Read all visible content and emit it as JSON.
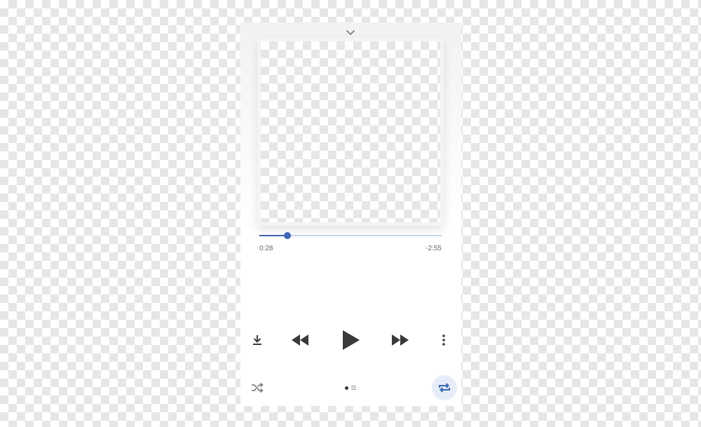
{
  "player": {
    "progress": {
      "elapsed": "0:28",
      "remaining": "-2:55",
      "fraction": 0.155
    },
    "controls": [
      {
        "name": "download",
        "icon": "download-icon"
      },
      {
        "name": "rewind",
        "icon": "rewind-icon"
      },
      {
        "name": "play",
        "icon": "play-icon"
      },
      {
        "name": "fast-forward",
        "icon": "fast-forward-icon"
      },
      {
        "name": "more",
        "icon": "more-vertical-icon"
      }
    ],
    "bottom": {
      "shuffle_icon": "shuffle-icon",
      "repeat_icon": "repeat-icon",
      "pages": 2,
      "active_page": 1
    },
    "colors": {
      "accent": "#3b66b2",
      "track": "#c9d3e6",
      "icon": "#3a3a3a",
      "icon_muted": "#777777",
      "repeat_bg": "#e6edf8",
      "time_text": "#666666"
    }
  }
}
